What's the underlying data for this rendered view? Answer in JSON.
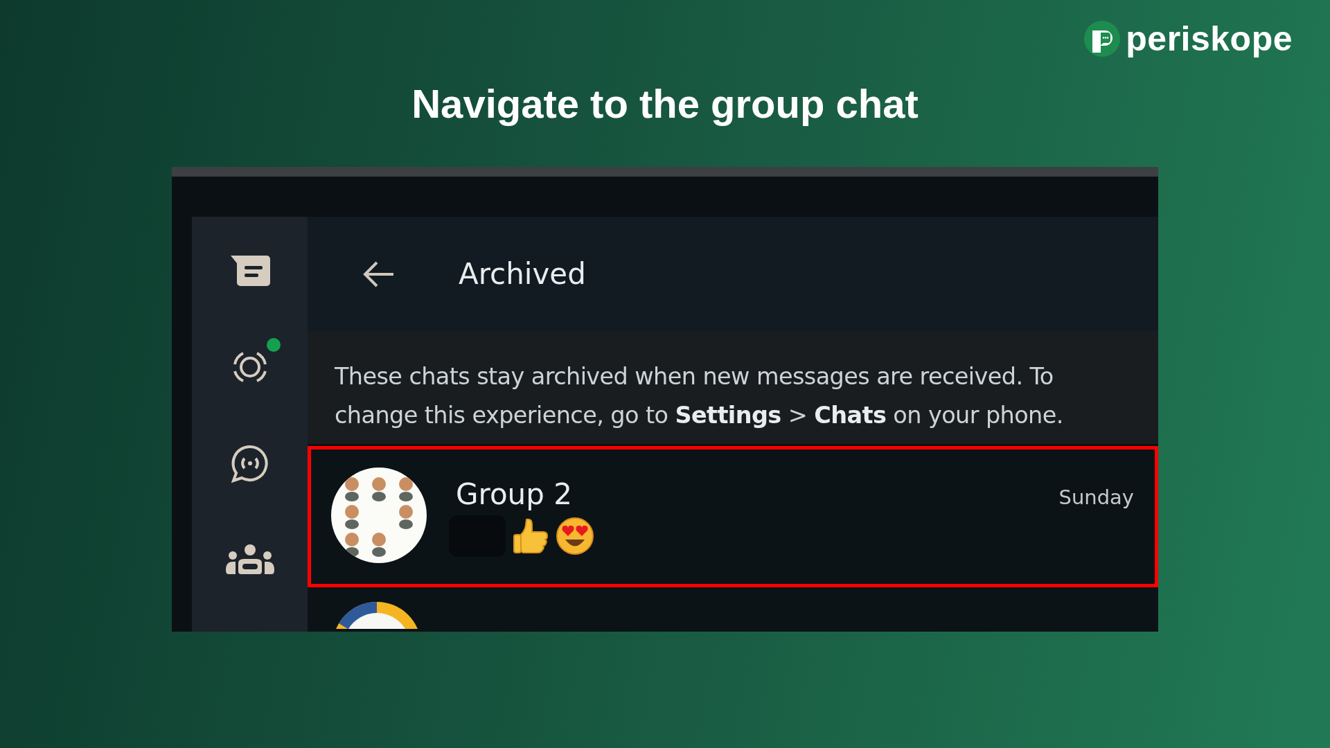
{
  "brand": {
    "logo": "periskope"
  },
  "title": "Navigate to the group chat",
  "sidebar": {
    "items": [
      {
        "kind": "chats",
        "unread": false
      },
      {
        "kind": "status",
        "unread": true
      },
      {
        "kind": "channels",
        "unread": false
      },
      {
        "kind": "communities",
        "unread": false
      }
    ]
  },
  "archived": {
    "title": "Archived",
    "notice": "These chats stay archived when new messages are received. To change this experience, go to **Settings** > **Chats** on your phone."
  },
  "chats": [
    {
      "name": "Group 2",
      "time": "Sunday",
      "highlighted": true,
      "preview": [
        {
          "kind": "redacted"
        },
        {
          "kind": "thumbs_up"
        },
        {
          "kind": "heart_eyes"
        }
      ]
    },
    {
      "highlighted": false
    }
  ]
}
